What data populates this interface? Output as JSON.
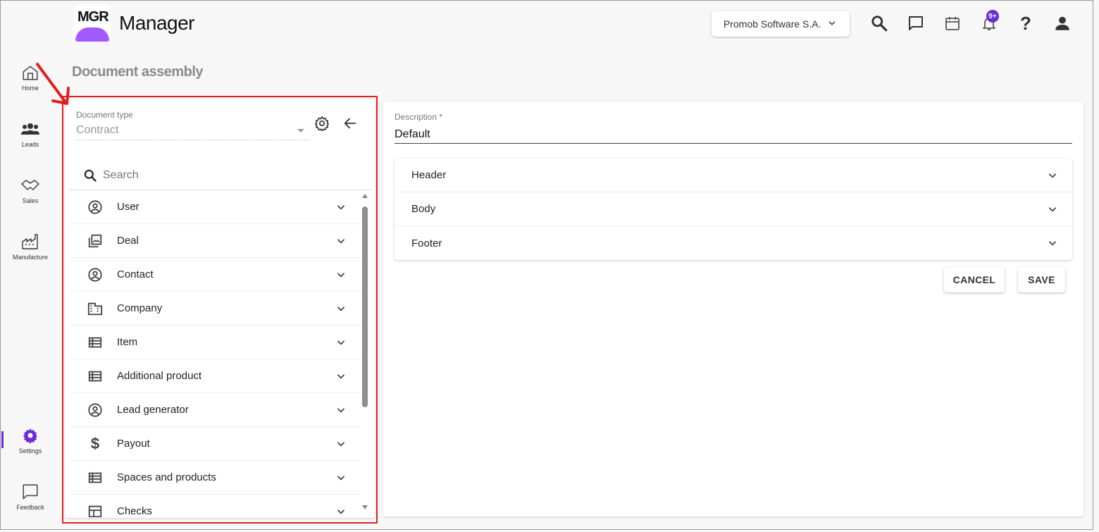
{
  "app": {
    "logo_text": "MGR",
    "title": "Manager",
    "brand_color": "#a259ff",
    "accent_color": "#6b2bd9",
    "highlight_color": "#e02020"
  },
  "header": {
    "company": "Promob Software S.A.",
    "icons": [
      "search-icon",
      "chat-icon",
      "calendar-icon",
      "bell-icon",
      "help-icon",
      "account-icon"
    ],
    "notifications_badge": "9+"
  },
  "sidebar": {
    "items": [
      {
        "label": "Home",
        "icon": "home-icon"
      },
      {
        "label": "Leads",
        "icon": "people-icon"
      },
      {
        "label": "Sales",
        "icon": "handshake-icon"
      },
      {
        "label": "Manufacture",
        "icon": "factory-icon"
      },
      {
        "label": "Settings",
        "icon": "gear-icon",
        "active": true
      },
      {
        "label": "Feedback",
        "icon": "feedback-icon"
      }
    ]
  },
  "page": {
    "title": "Document assembly"
  },
  "left_panel": {
    "document_type_label": "Document type",
    "document_type_value": "Contract",
    "search_placeholder": "Search",
    "items": [
      {
        "label": "User",
        "icon": "account-circle-icon"
      },
      {
        "label": "Deal",
        "icon": "photo-library-icon"
      },
      {
        "label": "Contact",
        "icon": "account-circle-icon"
      },
      {
        "label": "Company",
        "icon": "building-icon"
      },
      {
        "label": "Item",
        "icon": "list-icon"
      },
      {
        "label": "Additional product",
        "icon": "list-icon"
      },
      {
        "label": "Lead generator",
        "icon": "account-circle-icon"
      },
      {
        "label": "Payout",
        "icon": "dollar-icon"
      },
      {
        "label": "Spaces and products",
        "icon": "list-icon"
      },
      {
        "label": "Checks",
        "icon": "table-icon"
      }
    ]
  },
  "right_panel": {
    "description_label": "Description *",
    "description_value": "Default",
    "sections": [
      {
        "label": "Header"
      },
      {
        "label": "Body"
      },
      {
        "label": "Footer"
      }
    ],
    "cancel_label": "CANCEL",
    "save_label": "SAVE"
  }
}
